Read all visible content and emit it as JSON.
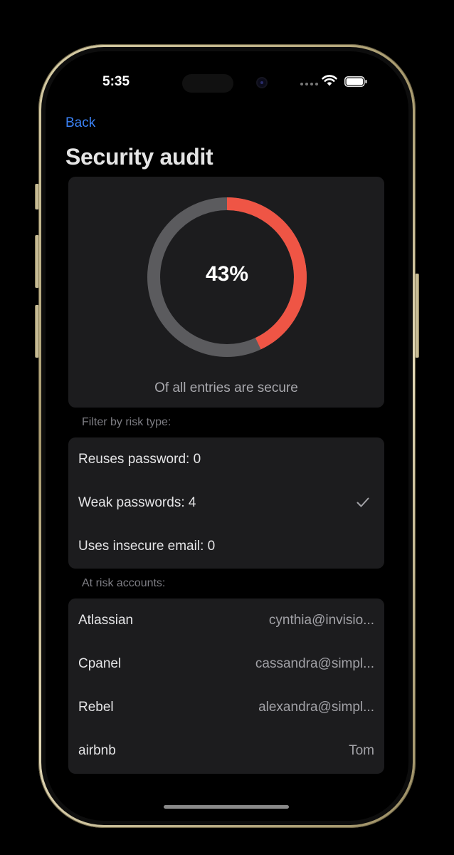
{
  "status_bar": {
    "time": "5:35"
  },
  "nav": {
    "back_label": "Back",
    "title": "Security audit"
  },
  "score": {
    "percent_label": "43%",
    "secure_fraction": 0.43,
    "caption": "Of all entries are secure",
    "colors": {
      "secure": "#ef5545",
      "track": "#5b5b5e"
    }
  },
  "filter": {
    "section_label": "Filter by risk type:",
    "options": [
      {
        "label": "Reuses password: 0",
        "selected": false
      },
      {
        "label": "Weak passwords: 4",
        "selected": true
      },
      {
        "label": "Uses insecure email: 0",
        "selected": false
      }
    ]
  },
  "accounts": {
    "section_label": "At risk accounts:",
    "items": [
      {
        "name": "Atlassian",
        "user": "cynthia@invisio..."
      },
      {
        "name": "Cpanel",
        "user": "cassandra@simpl..."
      },
      {
        "name": "Rebel",
        "user": "alexandra@simpl..."
      },
      {
        "name": "airbnb",
        "user": "Tom"
      }
    ]
  },
  "colors": {
    "accent": "#3b82f6",
    "background": "#000000",
    "card": "#1c1c1e"
  }
}
